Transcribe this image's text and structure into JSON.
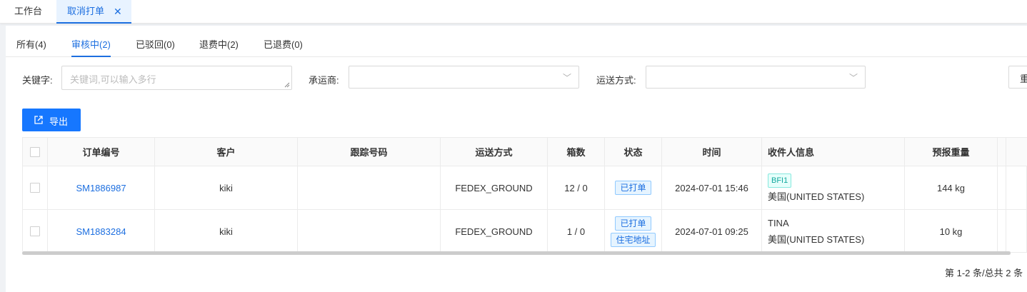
{
  "tabs": [
    {
      "label": "工作台"
    },
    {
      "label": "取消打单"
    }
  ],
  "subtabs": [
    {
      "label": "所有(4)"
    },
    {
      "label": "审核中(2)"
    },
    {
      "label": "已驳回(0)"
    },
    {
      "label": "退费中(2)"
    },
    {
      "label": "已退费(0)"
    }
  ],
  "filters": {
    "keyword_label": "关键字:",
    "keyword_placeholder": "关键词,可以输入多行",
    "carrier_label": "承运商:",
    "shipping_label": "运送方式:",
    "reset_label": "重"
  },
  "export_label": "导出",
  "table": {
    "headers": [
      "订单编号",
      "客户",
      "跟踪号码",
      "运送方式",
      "箱数",
      "状态",
      "时间",
      "收件人信息",
      "预报重量"
    ],
    "rows": [
      {
        "order": "SM1886987",
        "customer": "kiki",
        "tracking": "",
        "shipping": "FEDEX_GROUND",
        "boxes": "12 / 0",
        "status_tags": [
          "已打单"
        ],
        "time": "2024-07-01 15:46",
        "recipient_tag": "BFI1",
        "recipient_name": "",
        "recipient_country": "美国(UNITED STATES)",
        "weight": "144 kg"
      },
      {
        "order": "SM1883284",
        "customer": "kiki",
        "tracking": "",
        "shipping": "FEDEX_GROUND",
        "boxes": "1 / 0",
        "status_tags": [
          "已打单",
          "住宅地址"
        ],
        "time": "2024-07-01 09:25",
        "recipient_tag": "",
        "recipient_name": "TINA",
        "recipient_country": "美国(UNITED STATES)",
        "weight": "10 kg"
      }
    ]
  },
  "pagination_text": "第 1-2 条/总共 2 条"
}
